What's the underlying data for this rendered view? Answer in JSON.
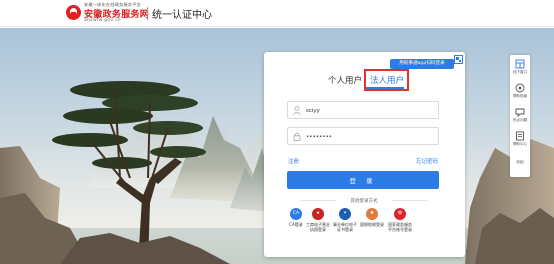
{
  "header": {
    "tagline": "安徽一体化在线政务服务平台",
    "site_name": "安徽政务服务网",
    "site_url": "ahzwfw.gov.cn",
    "title": "统一认证中心"
  },
  "login": {
    "qr_tip": "用皖事通app扫码登录",
    "tabs": [
      {
        "label": "个人用户",
        "active": false
      },
      {
        "label": "法人用户",
        "active": true
      }
    ],
    "username_value": "sciyy",
    "password_value": "••••••••",
    "register_label": "注册",
    "forgot_label": "忘记密码",
    "login_button": "登 录",
    "other_methods_title": "其他登录方式",
    "methods": [
      {
        "label": "CA登录",
        "icon": "ca-icon",
        "color": "#2d7be5",
        "glyph": "CA"
      },
      {
        "label": "工商电子营业执照登录",
        "icon": "business-license-icon",
        "color": "#c8231f",
        "glyph": "★"
      },
      {
        "label": "事业单位电子证书登录",
        "icon": "public-institution-icon",
        "color": "#1a5fb4",
        "glyph": "✦"
      },
      {
        "label": "国税地税登录",
        "icon": "tax-icon",
        "color": "#e2793a",
        "glyph": "✹"
      },
      {
        "label": "国家政务服务平台账号登录",
        "icon": "national-platform-icon",
        "color": "#d8262b",
        "glyph": "✪"
      }
    ]
  },
  "sidebar": [
    {
      "label": "线下窗口",
      "icon": "window-icon"
    },
    {
      "label": "帮助指南",
      "icon": "guide-icon"
    },
    {
      "label": "热点问题",
      "icon": "question-icon"
    },
    {
      "label": "帮助中心",
      "icon": "help-center-icon"
    },
    {
      "label": "收起",
      "icon": "collapse-icon"
    }
  ],
  "colors": {
    "accent": "#2d7be5",
    "brand_red": "#d7201f",
    "highlight": "#e53030"
  }
}
